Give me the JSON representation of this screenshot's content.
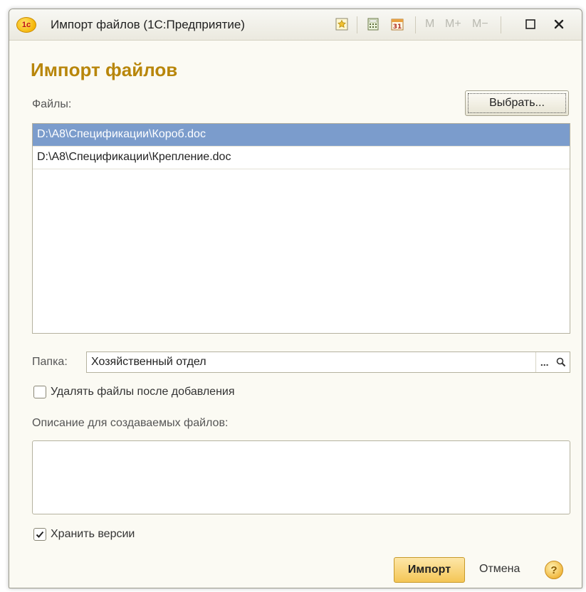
{
  "window": {
    "title": "Импорт файлов  (1С:Предприятие)",
    "logo_text": "1с",
    "memory_buttons": [
      "M",
      "M+",
      "M−"
    ]
  },
  "form": {
    "title": "Импорт файлов",
    "files_label": "Файлы:",
    "choose_button": "Выбрать...",
    "files": [
      {
        "path": "D:\\A8\\Спецификации\\Короб.doc",
        "selected": true
      },
      {
        "path": "D:\\A8\\Спецификации\\Крепление.doc",
        "selected": false
      }
    ],
    "folder_label": "Папка:",
    "folder_value": "Хозяйственный отдел",
    "delete_after_label": "Удалять файлы после добавления",
    "delete_after_checked": false,
    "description_label": "Описание для создаваемых файлов:",
    "description_value": "",
    "keep_versions_label": "Хранить версии",
    "keep_versions_checked": true
  },
  "footer": {
    "import_button": "Импорт",
    "cancel_link": "Отмена",
    "help": "?"
  },
  "colors": {
    "title_accent": "#b8860b",
    "selection": "#7b9ccc",
    "import_button": "#f4c656"
  }
}
